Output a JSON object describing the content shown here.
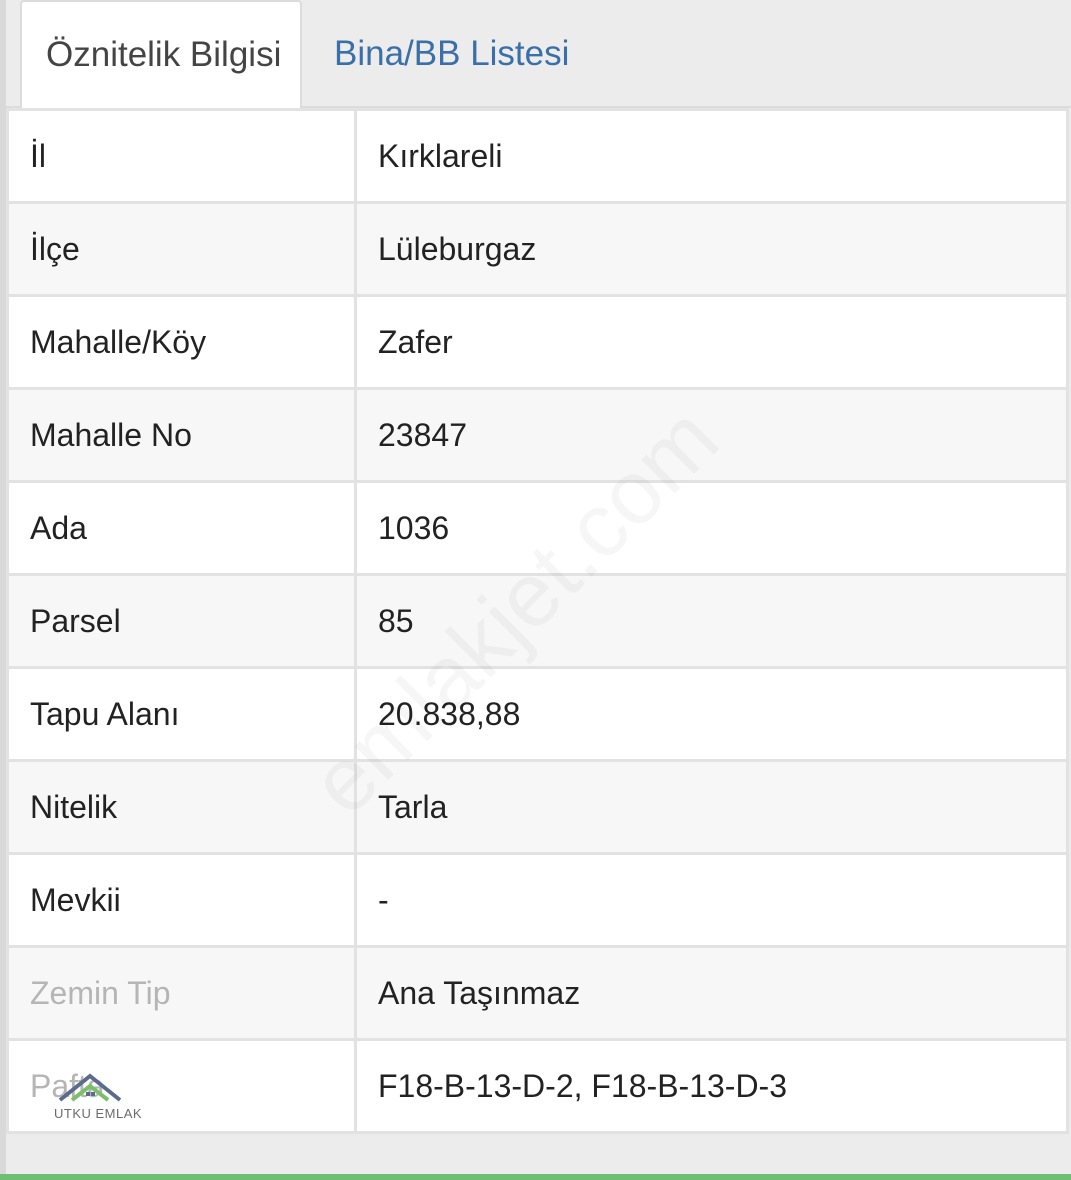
{
  "tabs": [
    {
      "label": "Öznitelik Bilgisi",
      "active": true
    },
    {
      "label": "Bina/BB Listesi",
      "active": false
    }
  ],
  "rows": [
    {
      "key": "İl",
      "value": "Kırklareli"
    },
    {
      "key": "İlçe",
      "value": "Lüleburgaz"
    },
    {
      "key": "Mahalle/Köy",
      "value": "Zafer"
    },
    {
      "key": "Mahalle No",
      "value": "23847"
    },
    {
      "key": "Ada",
      "value": "1036"
    },
    {
      "key": "Parsel",
      "value": "85"
    },
    {
      "key": "Tapu Alanı",
      "value": "20.838,88"
    },
    {
      "key": "Nitelik",
      "value": "Tarla"
    },
    {
      "key": "Mevkii",
      "value": "-"
    },
    {
      "key": "Zemin Tip",
      "value": "Ana Taşınmaz"
    },
    {
      "key": "Pafta",
      "value": "F18-B-13-D-2, F18-B-13-D-3"
    }
  ],
  "logo": {
    "text": "UTKU EMLAK",
    "icon": "house-roof-icon"
  },
  "watermark": "emlakjet.com",
  "colors": {
    "active_tab_text": "#444444",
    "inactive_tab_text": "#3a6fa8",
    "border": "#e2e2e2",
    "bottom_bar": "#6fbf73"
  }
}
